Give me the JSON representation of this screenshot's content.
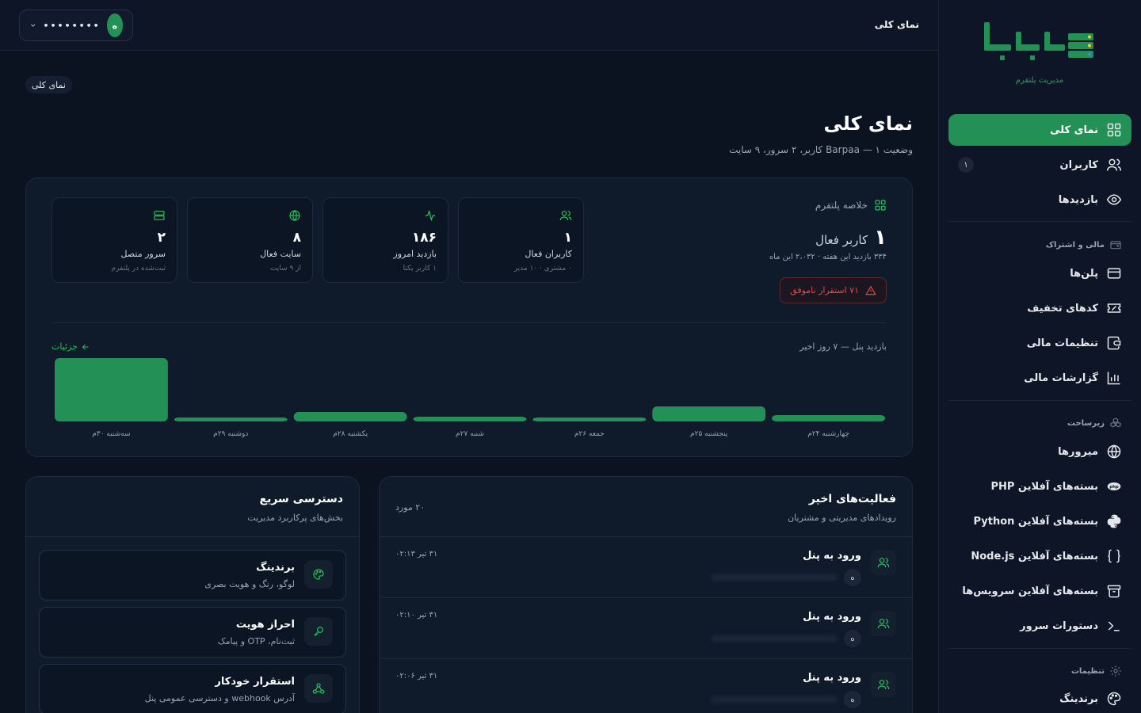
{
  "brand": {
    "logo_text": "هبریا",
    "subtitle": "مدیریت پلتفرم"
  },
  "colors": {
    "accent": "#239155",
    "accent_bright": "#22c55e",
    "danger": "#ef4444",
    "background": "#0b1220"
  },
  "sidebar": {
    "items": [
      {
        "label": "نمای کلی",
        "icon": "dashboard-grid-icon",
        "active": true
      },
      {
        "label": "کاربران",
        "icon": "users-icon",
        "badge": "۱"
      },
      {
        "label": "بازدیدها",
        "icon": "eye-icon"
      }
    ],
    "sections": [
      {
        "title": "مالی و اشتراک",
        "icon": "wallet-icon",
        "items": [
          {
            "label": "پلن‌ها",
            "icon": "credit-card-icon"
          },
          {
            "label": "کدهای تخفیف",
            "icon": "ticket-icon"
          },
          {
            "label": "تنظیمات مالی",
            "icon": "wallet-settings-icon"
          },
          {
            "label": "گزارشات مالی",
            "icon": "bar-chart-icon"
          }
        ]
      },
      {
        "title": "زیرساخت",
        "icon": "boxes-icon",
        "items": [
          {
            "label": "میرورها",
            "icon": "globe-icon"
          },
          {
            "label": "بسته‌های آفلاین PHP",
            "icon": "php-icon"
          },
          {
            "label": "بسته‌های آفلاین Python",
            "icon": "python-icon"
          },
          {
            "label": "بسته‌های آفلاین Node.js",
            "icon": "braces-icon"
          },
          {
            "label": "بسته‌های آفلاین سرویس‌ها",
            "icon": "archive-icon"
          },
          {
            "label": "دستورات سرور",
            "icon": "terminal-icon"
          }
        ]
      },
      {
        "title": "تنظیمات",
        "icon": "gear-icon",
        "items": [
          {
            "label": "برندینگ",
            "icon": "palette-icon"
          }
        ]
      }
    ]
  },
  "topbar": {
    "title": "نمای کلی",
    "user_name": "••••••••",
    "avatar_letter": "ه"
  },
  "breadcrumb": "نمای کلی",
  "page": {
    "title": "نمای کلی",
    "subtitle": "وضعیت Barpaa — ۱ کاربر، ۲ سرور، ۹ سایت"
  },
  "summary": {
    "heading": "خلاصه پلتفرم",
    "big_value": "۱",
    "big_label": "کاربر فعال",
    "meta": "۳۳۴ بازدید این هفته · ۲،۰۳۲ این ماه",
    "failed_badge": "۷۱ استقرار ناموفق",
    "stats": [
      {
        "value": "۱",
        "label": "کاربران فعال",
        "sub": "۰ مشتری · ۱۰ مدیر",
        "icon": "users-icon"
      },
      {
        "value": "۱۸۶",
        "label": "بازدید امروز",
        "sub": "۱ کاربر یکتا",
        "icon": "activity-icon"
      },
      {
        "value": "۸",
        "label": "سایت فعال",
        "sub": "از ۹ سایت",
        "icon": "globe-icon"
      },
      {
        "value": "۲",
        "label": "سرور متصل",
        "sub": "ثبت‌شده در پلتفرم",
        "icon": "server-icon"
      }
    ]
  },
  "chart_header": {
    "title": "بازدید پنل — ۷ روز اخیر",
    "link": "جزئیات"
  },
  "chart_data": {
    "type": "bar",
    "categories": [
      "چهارشنبه ۲۴م",
      "پنجشنبه ۲۵م",
      "جمعه ۲۶م",
      "شنبه ۲۷م",
      "یکشنبه ۲۸م",
      "دوشنبه ۲۹م",
      "سه‌شنبه ۳۰م"
    ],
    "values": [
      8,
      19,
      5,
      6,
      12,
      5,
      80
    ],
    "xlabel": "",
    "ylabel": "",
    "ylim": [
      0,
      80
    ],
    "grid": false
  },
  "activities": {
    "title": "فعالیت‌های اخیر",
    "subtitle": "رویدادهای مدیریتی و مشتریان",
    "count": "۲۰ مورد",
    "items": [
      {
        "title": "ورود به پنل",
        "time": "۳۱ تیر ۰۲:۱۳",
        "chip": "ه"
      },
      {
        "title": "ورود به پنل",
        "time": "۳۱ تیر ۰۲:۱۰",
        "chip": "ه"
      },
      {
        "title": "ورود به پنل",
        "time": "۳۱ تیر ۰۲:۰۶",
        "chip": "ه"
      }
    ]
  },
  "quick_access": {
    "title": "دسترسی سریع",
    "subtitle": "بخش‌های پرکاربرد مدیریت",
    "items": [
      {
        "title": "برندینگ",
        "sub": "لوگو، رنگ و هویت بصری",
        "icon": "palette-icon"
      },
      {
        "title": "احراز هویت",
        "sub": "ثبت‌نام، OTP و پیامک",
        "icon": "key-icon"
      },
      {
        "title": "استقرار خودکار",
        "sub": "آدرس webhook و دسترسی عمومی پنل",
        "icon": "webhook-icon"
      }
    ]
  }
}
